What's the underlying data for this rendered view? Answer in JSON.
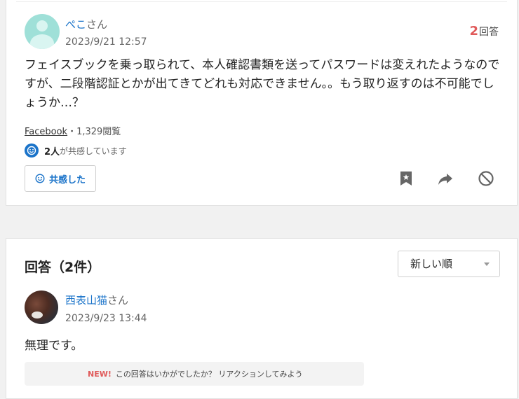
{
  "question": {
    "user_name": "ぺこ",
    "honorific": "さん",
    "date": "2023/9/21 12:57",
    "answer_count": "2",
    "answer_count_suffix": "回答",
    "text": "フェイスブックを乗っ取られて、本人確認書類を送ってパスワードは変えれたようなのですが、二段階認証とかが出てきてどれも対応できません。。もう取り返すのは不可能でしょうか…？",
    "category": "Facebook",
    "views": "・1,329閲覧",
    "empathy_count": "2人",
    "empathy_suffix": "が共感しています",
    "empathy_button": "共感した",
    "icons": [
      "bookmark-icon",
      "share-icon",
      "block-icon"
    ],
    "colors": {
      "accent": "#1a73c9",
      "count": "#e05a5a"
    }
  },
  "answers": {
    "title": "回答（2件）",
    "sort_selected": "新しい順",
    "items": [
      {
        "user_name": "西表山猫",
        "honorific": "さん",
        "date": "2023/9/23 13:44",
        "text": "無理です。"
      }
    ],
    "reaction_new": "NEW!",
    "reaction_text": "この回答はいかがでしたか？ リアクションしてみよう"
  }
}
